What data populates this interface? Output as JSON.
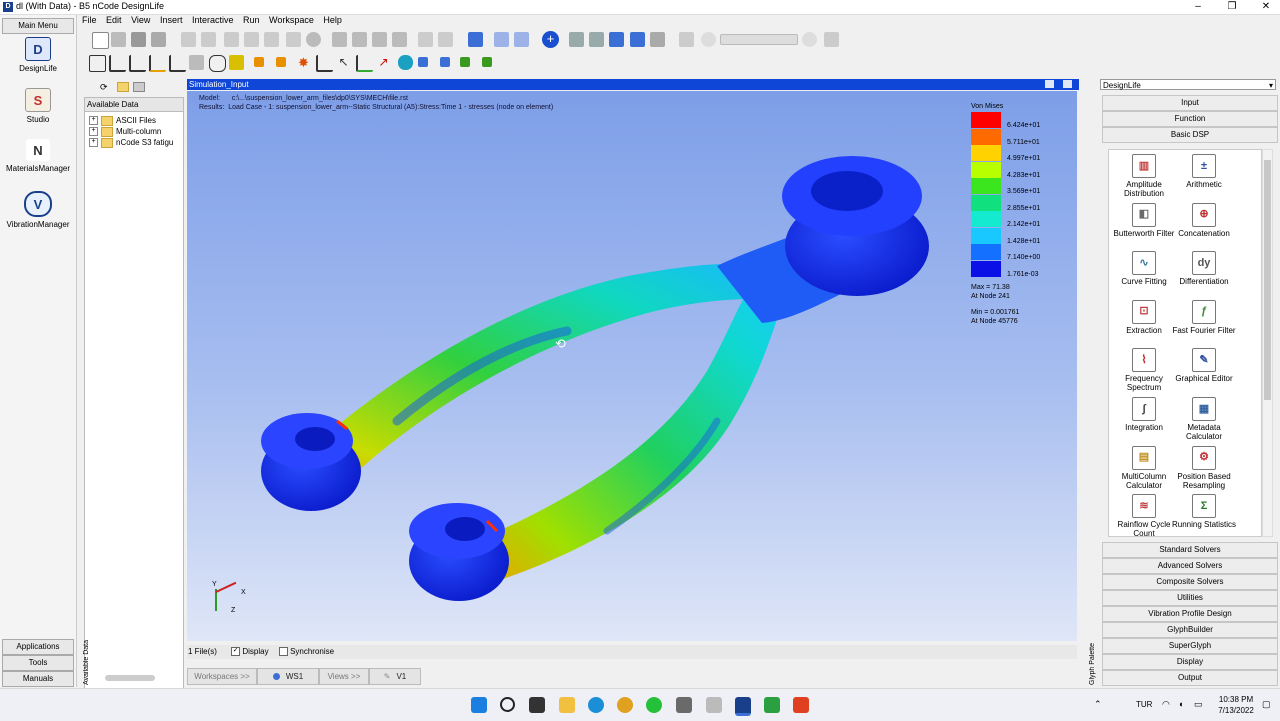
{
  "window": {
    "title": "dl (With Data) - B5 nCode DesignLife",
    "logo": "D"
  },
  "menu": [
    "File",
    "Edit",
    "View",
    "Insert",
    "Interactive",
    "Run",
    "Workspace",
    "Help"
  ],
  "left_panel": {
    "main_menu": "Main Menu",
    "tools": [
      {
        "label": "DesignLife",
        "icon": "D"
      },
      {
        "label": "Studio",
        "icon": "S"
      },
      {
        "label": "MaterialsManager",
        "icon": "N"
      },
      {
        "label": "VibrationManager",
        "icon": "V"
      }
    ],
    "bottom_buttons": [
      "Applications",
      "Tools",
      "Manuals"
    ]
  },
  "data_panel": {
    "header": "Available Data",
    "side_label": "Available Data",
    "items": [
      "ASCII Files",
      "Multi-column",
      "nCode S3 fatigu"
    ]
  },
  "viewport": {
    "title": "Simulation_Input",
    "model_label": "Model:",
    "model_value": "c:\\...\\suspension_lower_arm_files\\dp0\\SYS\\MECH\\file.rst",
    "results_label": "Results:",
    "results_value": "Load Case - 1: suspension_lower_arm--Static Structural (A5):Stress:Time 1 - stresses (node on element)",
    "legend": {
      "title": "Von Mises",
      "labels": [
        "6.424e+01",
        "5.711e+01",
        "4.997e+01",
        "4.283e+01",
        "3.569e+01",
        "2.855e+01",
        "2.142e+01",
        "1.428e+01",
        "7.140e+00",
        "1.761e-03"
      ],
      "colors": [
        "#ff0000",
        "#ff6a00",
        "#ffd200",
        "#b8ff00",
        "#3ce61e",
        "#10e07e",
        "#14ead0",
        "#18c8ff",
        "#1470ff",
        "#0a10e6"
      ],
      "max_text": "Max = 71.38",
      "max_node": "At Node 241",
      "min_text": "Min = 0.001761",
      "min_node": "At Node 45776"
    },
    "axes": {
      "y": "Y",
      "x": "X",
      "z": "Z"
    }
  },
  "status_strip": {
    "files": "1 File(s)",
    "display": "Display",
    "synchronise": "Synchronise"
  },
  "bottom_tabs": {
    "workspaces": "Workspaces >>",
    "ws1": "WS1",
    "views": "Views >>",
    "v1": "V1"
  },
  "glyph_palette": {
    "dropdown": "DesignLife",
    "side_label": "Glyph Palette",
    "top_categories": [
      "Input",
      "Function",
      "Basic DSP"
    ],
    "glyphs": [
      {
        "label": "Amplitude Distribution",
        "icon": "▥"
      },
      {
        "label": "Arithmetic",
        "icon": "±"
      },
      {
        "label": "Butterworth Filter",
        "icon": "◧"
      },
      {
        "label": "Concatenation",
        "icon": "⊕"
      },
      {
        "label": "Curve Fitting",
        "icon": "∿"
      },
      {
        "label": "Differentiation",
        "icon": "dy"
      },
      {
        "label": "Extraction",
        "icon": "⊡"
      },
      {
        "label": "Fast Fourier Filter",
        "icon": "ƒ"
      },
      {
        "label": "Frequency Spectrum",
        "icon": "⌇"
      },
      {
        "label": "Graphical Editor",
        "icon": "✎"
      },
      {
        "label": "Integration",
        "icon": "∫"
      },
      {
        "label": "Metadata Calculator",
        "icon": "▦"
      },
      {
        "label": "MultiColumn Calculator",
        "icon": "▤"
      },
      {
        "label": "Position Based Resampling",
        "icon": "⚙"
      },
      {
        "label": "Rainflow Cycle Count",
        "icon": "≋"
      },
      {
        "label": "Running Statistics",
        "icon": "Σ"
      }
    ],
    "bottom_categories": [
      "Standard Solvers",
      "Advanced Solvers",
      "Composite Solvers",
      "Utilities",
      "Vibration Profile Design",
      "GlyphBuilder",
      "SuperGlyph",
      "Display",
      "Output"
    ]
  },
  "taskbar": {
    "lang": "TUR",
    "time": "10:38 PM",
    "date": "7/13/2022"
  }
}
